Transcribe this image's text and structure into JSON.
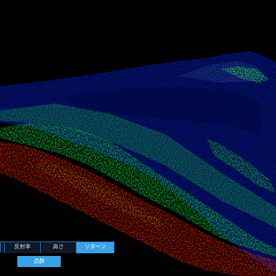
{
  "view": {
    "background": "#000000",
    "point_colors": {
      "low": "#0000ff",
      "mid": "#00cc33",
      "high": "#ff2200"
    }
  },
  "mode_tabs": [
    {
      "label": ""
    },
    {
      "label": "反射率"
    },
    {
      "label": "高さ"
    },
    {
      "label": "リターン",
      "active": true
    }
  ],
  "action_button": {
    "label": "点群"
  }
}
